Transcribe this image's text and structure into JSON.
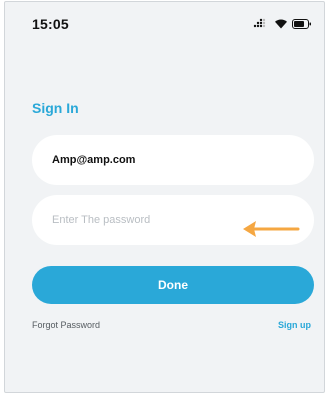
{
  "status_bar": {
    "time": "15:05",
    "icons": [
      "signal-icon",
      "wifi-icon",
      "battery-icon"
    ]
  },
  "signin": {
    "title": "Sign In",
    "email_value": "Amp@amp.com",
    "password_placeholder": "Enter The password",
    "done_label": "Done",
    "forgot_label": "Forgot Password",
    "signup_label": "Sign up"
  },
  "colors": {
    "accent": "#2aa8d8",
    "background": "#f1f3f5",
    "arrow": "#f5a742"
  }
}
